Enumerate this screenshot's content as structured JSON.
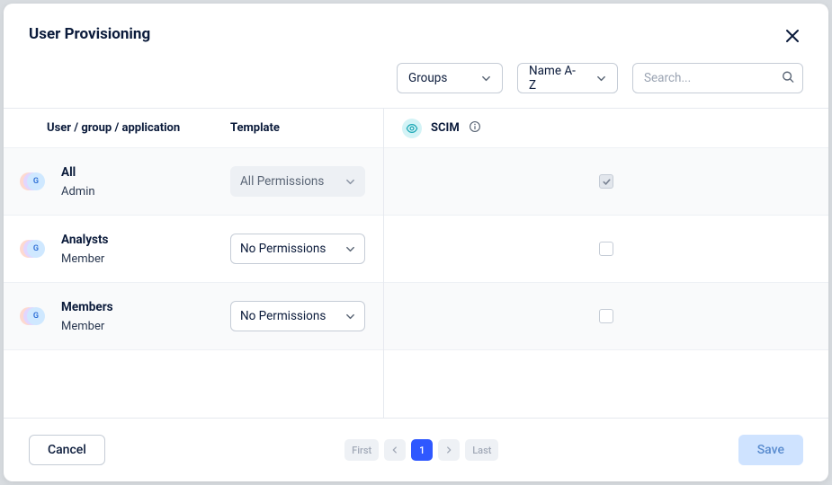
{
  "header": {
    "title": "User Provisioning"
  },
  "filters": {
    "scope_label": "Groups",
    "sort_label": "Name A-Z",
    "search_placeholder": "Search..."
  },
  "columns": {
    "name": "User / group / application",
    "template": "Template",
    "scim": "SCIM"
  },
  "group_badge_letter": "G",
  "rows": [
    {
      "name": "All",
      "role": "Admin",
      "template": "All Permissions",
      "template_disabled": true,
      "scim_checked": true,
      "scim_disabled": true
    },
    {
      "name": "Analysts",
      "role": "Member",
      "template": "No Permissions",
      "template_disabled": false,
      "scim_checked": false,
      "scim_disabled": false
    },
    {
      "name": "Members",
      "role": "Member",
      "template": "No Permissions",
      "template_disabled": false,
      "scim_checked": false,
      "scim_disabled": false
    }
  ],
  "pagination": {
    "first": "First",
    "last": "Last",
    "current": "1"
  },
  "footer": {
    "cancel": "Cancel",
    "save": "Save"
  }
}
